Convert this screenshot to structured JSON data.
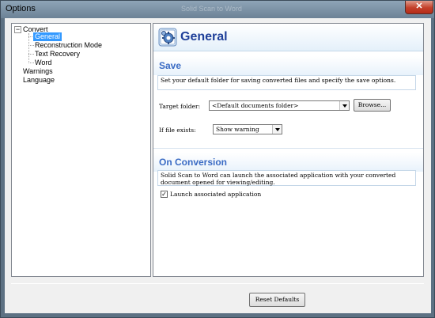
{
  "window": {
    "title": "Options",
    "ghost_title": "Solid Scan to Word",
    "close_glyph": "✕"
  },
  "tree": {
    "expander_glyph": "−",
    "items": [
      {
        "label": "Convert"
      },
      {
        "label": "General"
      },
      {
        "label": "Reconstruction Mode"
      },
      {
        "label": "Text Recovery"
      },
      {
        "label": "Word"
      },
      {
        "label": "Warnings"
      },
      {
        "label": "Language"
      }
    ]
  },
  "panel": {
    "title": "General",
    "icon": "settings-gear-icon",
    "save": {
      "heading": "Save",
      "description": "Set your default folder for saving converted files and specify the save options.",
      "target_folder_label": "Target folder:",
      "target_folder_value": "<Default documents folder>",
      "browse_label": "Browse...",
      "if_exists_label": "If file exists:",
      "if_exists_value": "Show warning"
    },
    "conversion": {
      "heading": "On Conversion",
      "description": "Solid Scan to Word can launch the associated application with your converted document opened for viewing/editing.",
      "launch_label": "Launch associated application",
      "launch_checked": true,
      "check_glyph": "✓"
    }
  },
  "footer": {
    "reset_label": "Reset Defaults"
  },
  "colors": {
    "heading_blue": "#3a6bc4",
    "title_blue": "#1f3f99",
    "selection": "#3399ff"
  }
}
